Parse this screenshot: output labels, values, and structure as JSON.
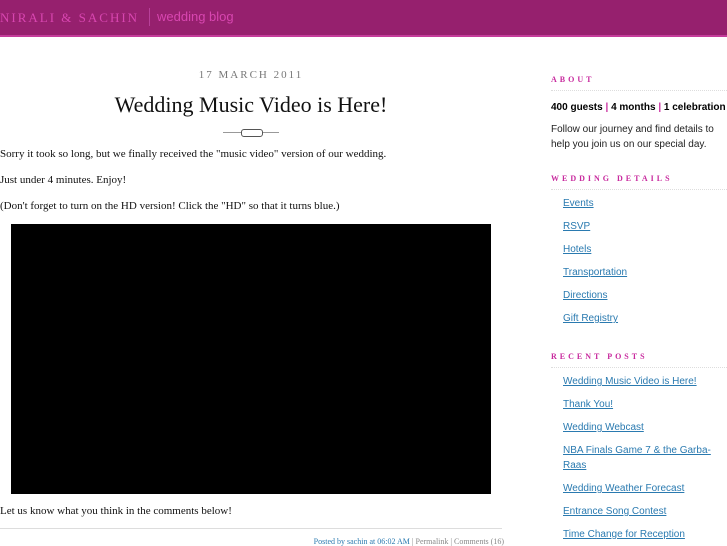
{
  "header": {
    "site_name": "NIRALI & SACHIN",
    "tagline": "wedding blog"
  },
  "post": {
    "date": "17 MARCH 2011",
    "title": "Wedding Music Video is Here!",
    "paragraphs": [
      "Sorry it took so long, but we finally received the \"music video\" version of our wedding.",
      "Just under 4 minutes. Enjoy!",
      "(Don't forget to turn on the HD version! Click the \"HD\" so that it turns blue.)"
    ],
    "closing": "Let us know what you think in the comments below!",
    "meta": {
      "posted": "Posted by sachin at 06:02 AM",
      "permalink": "Permalink",
      "comments": "Comments (16)"
    }
  },
  "sidebar": {
    "about": {
      "heading": "ABOUT",
      "stats": [
        "400 guests",
        "4 months",
        "1 celebration"
      ],
      "text": "Follow our journey and find details to help you join us on our special day."
    },
    "details": {
      "heading": "WEDDING DETAILS",
      "links": [
        "Events",
        "RSVP",
        "Hotels",
        "Transportation",
        "Directions",
        "Gift Registry"
      ]
    },
    "recent": {
      "heading": "RECENT POSTS",
      "links": [
        "Wedding Music Video is Here!",
        "Thank You!",
        "Wedding Webcast",
        "NBA Finals Game 7 & the Garba-Raas",
        "Wedding Weather Forecast",
        "Entrance Song Contest",
        "Time Change for Reception"
      ]
    }
  }
}
